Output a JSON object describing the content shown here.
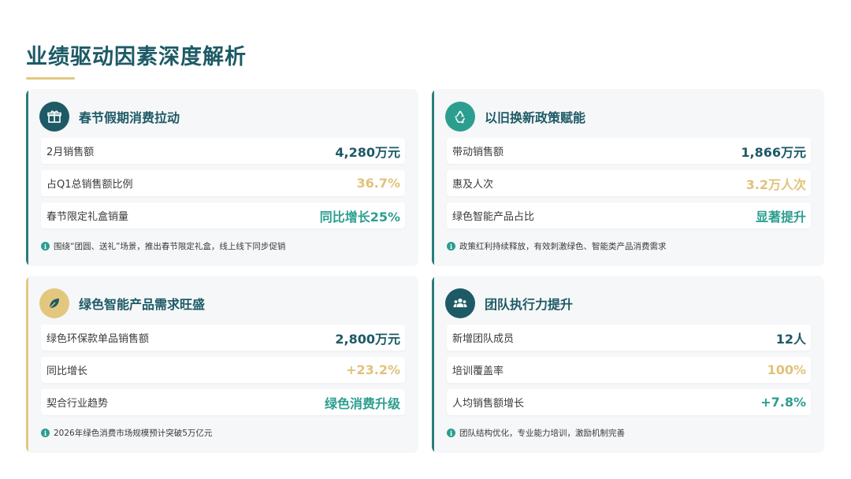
{
  "page": {
    "title": "业绩驱动因素深度解析"
  },
  "colors": {
    "dark": "#1d5a66",
    "teal": "#2c9e8f",
    "gold": "#e1c27a",
    "bar_teal": "#2a7d7a",
    "bar_gold": "#e3c77f"
  },
  "cards": [
    {
      "icon": "gift-icon",
      "title": "春节假期消费拉动",
      "rows": [
        {
          "label": "2月销售额",
          "value": "4,280万元"
        },
        {
          "label": "占Q1总销售额比例",
          "value": "36.7%"
        },
        {
          "label": "春节限定礼盒销量",
          "value": "同比增长25%"
        }
      ],
      "note": "围绕“团圆、送礼”场景，推出春节限定礼盒，线上线下同步促销"
    },
    {
      "icon": "recycle-icon",
      "title": "以旧换新政策赋能",
      "rows": [
        {
          "label": "带动销售额",
          "value": "1,866万元"
        },
        {
          "label": "惠及人次",
          "value": "3.2万人次"
        },
        {
          "label": "绿色智能产品占比",
          "value": "显著提升"
        }
      ],
      "note": "政策红利持续释放，有效刺激绿色、智能类产品消费需求"
    },
    {
      "icon": "leaf-icon",
      "title": "绿色智能产品需求旺盛",
      "rows": [
        {
          "label": "绿色环保款单品销售额",
          "value": "2,800万元"
        },
        {
          "label": "同比增长",
          "value": "+23.2%"
        },
        {
          "label": "契合行业趋势",
          "value": "绿色消费升级"
        }
      ],
      "note": "2026年绿色消费市场规模预计突破5万亿元"
    },
    {
      "icon": "team-icon",
      "title": "团队执行力提升",
      "rows": [
        {
          "label": "新增团队成员",
          "value": "12人"
        },
        {
          "label": "培训覆盖率",
          "value": "100%"
        },
        {
          "label": "人均销售额增长",
          "value": "+7.8%"
        }
      ],
      "note": "团队结构优化，专业能力培训，激励机制完善"
    }
  ]
}
